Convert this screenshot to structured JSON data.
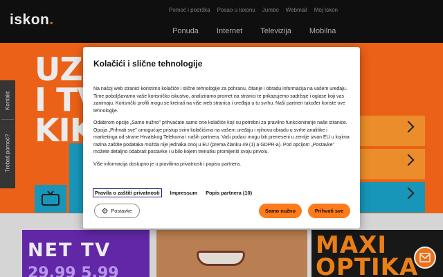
{
  "header": {
    "logo_text": "iskon",
    "logo_dot": ".",
    "top_links": [
      "Pomoć i podrška",
      "Posao u Iskonu",
      "Jumbo",
      "Webmail",
      "Moj Iskon"
    ],
    "main_nav": [
      "Ponuda",
      "Internet",
      "Televizija",
      "Mobilna"
    ]
  },
  "hero": {
    "lines": [
      "UZI",
      "I TV",
      "KIK"
    ],
    "side_tabs": [
      "Kontakt",
      "Trebaš pomoć?"
    ]
  },
  "lower": {
    "promo1_line1": "NET TV",
    "promo1_line2": "29,99 5,99",
    "promo3_line1": "MAXI",
    "promo3_line2": "OPTIKA"
  },
  "cookie_dialog": {
    "title": "Kolačići i slične tehnologije",
    "paragraphs": [
      "Na našoj web stranici koristimo kolačiće i slične tehnologije za pohranu, čitanje i obradu informacija na vašem uređaju. Time poboljšavamo vaše korisničko iskustvo, analiziramo promet na stranici te prikazujemo sadržaje i oglase koji vas zanimaju. Korisnički profili mogu se kreirati na više web stranica i uređaja u tu svrhu. Naši partneri također koriste ove tehnologije.",
      "Odabirom opcije „Samo nužno\" prihvaćate samo one kolačiće koji su potrebni za pravilno funkcioniranje naše stranice. Opcija „Prihvati sve\" omogućuje pristup svim kolačićima na vašem uređaju i njihovu obradu u svrhe analitike i marketinga od strane Hrvatskog Telekoma i naših partnera. Vaši podaci mogu biti preneseni u zemlje izvan EU u kojima razina zaštite podataka možda nije jednaka onoj u EU (prema članku 49 (1) a GDPR-a). Pod opcijom „Postavke\" možete detaljno odabrati postavke i u bilo kojem trenutku promijeniti svoju privolu.",
      "Više informacija dostupno je u pravilima privatnosti i popisu partnera."
    ],
    "links": {
      "privacy": "Pravila o zaštiti privatnosti",
      "impressum": "Impressum",
      "partners": "Popis partnera (10)"
    },
    "buttons": {
      "settings": "Postavke",
      "necessary": "Samo nužno",
      "accept_all": "Prihvati sve"
    }
  },
  "colors": {
    "brand_orange": "#ff7a1a",
    "hero_orange": "#ff6a1a",
    "teal": "#1aa3c9",
    "purple": "#6a2bb5"
  }
}
